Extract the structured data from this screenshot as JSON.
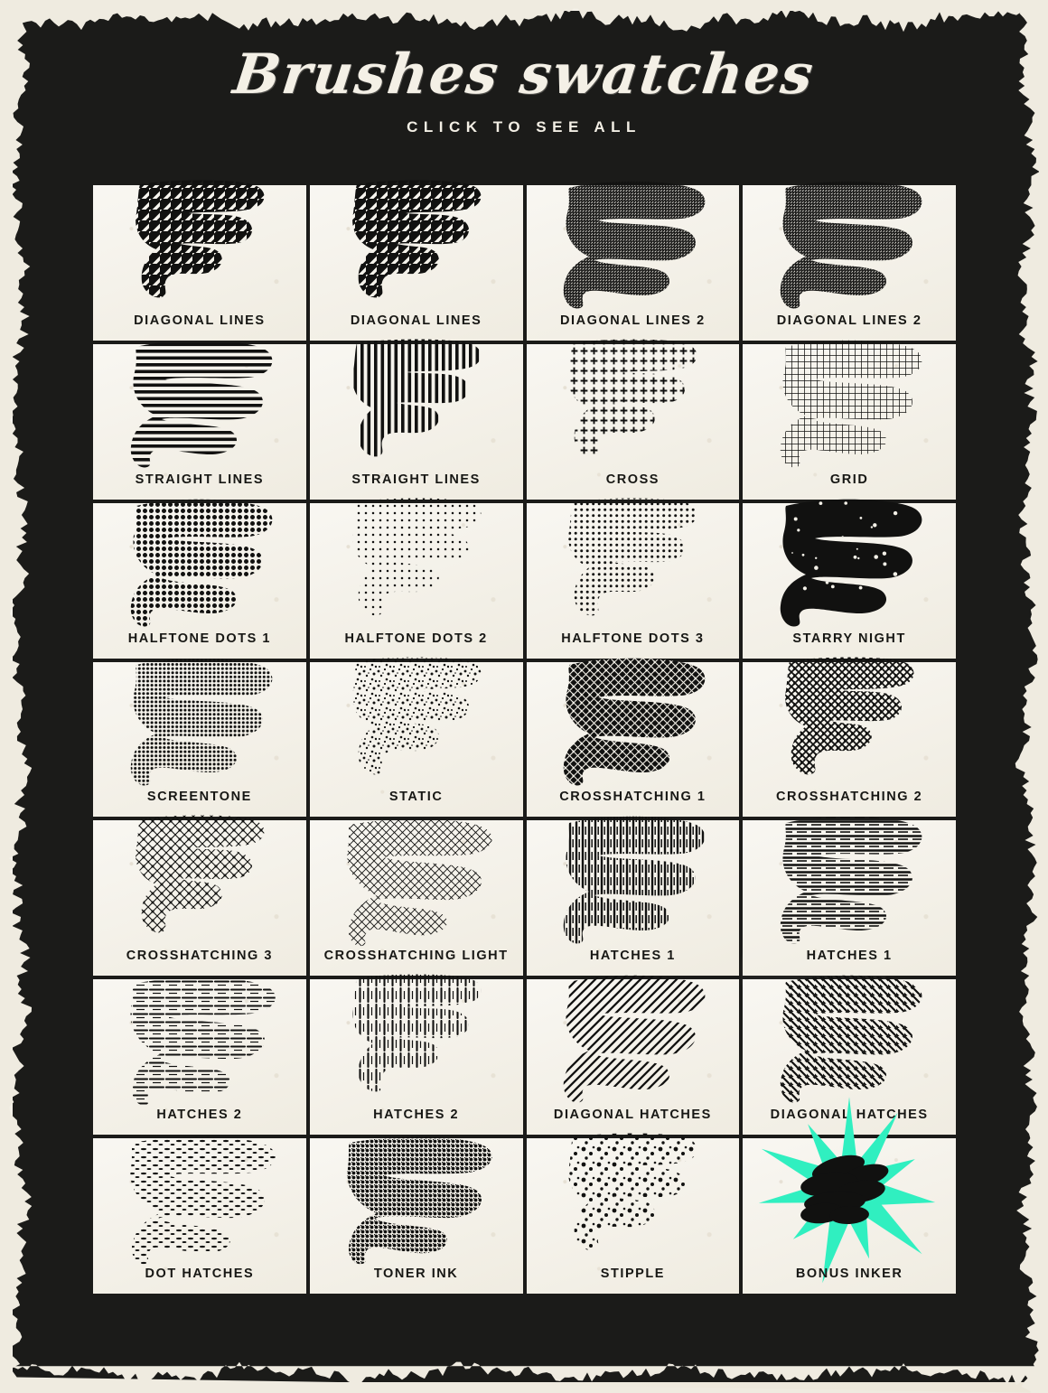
{
  "header": {
    "title": "Brushes swatches",
    "subtitle": "CLICK TO SEE ALL"
  },
  "colors": {
    "frame_dark": "#1b1b19",
    "paper_cream": "#f3f0e7",
    "ink_black": "#111110",
    "accent_teal": "#30efc0"
  },
  "swatches": [
    {
      "label": "DIAGONAL LINES",
      "pattern": "diag-coarse"
    },
    {
      "label": "DIAGONAL LINES",
      "pattern": "diag-coarse-b"
    },
    {
      "label": "DIAGONAL LINES 2",
      "pattern": "diag-fine"
    },
    {
      "label": "DIAGONAL LINES 2",
      "pattern": "diag-fine-b"
    },
    {
      "label": "STRAIGHT LINES",
      "pattern": "horiz-lines"
    },
    {
      "label": "STRAIGHT LINES",
      "pattern": "vert-lines"
    },
    {
      "label": "CROSS",
      "pattern": "cross-plus"
    },
    {
      "label": "GRID",
      "pattern": "grid-mesh"
    },
    {
      "label": "HALFTONE DOTS 1",
      "pattern": "halftone-1"
    },
    {
      "label": "HALFTONE DOTS 2",
      "pattern": "halftone-2"
    },
    {
      "label": "HALFTONE DOTS 3",
      "pattern": "halftone-3"
    },
    {
      "label": "STARRY NIGHT",
      "pattern": "starry"
    },
    {
      "label": "SCREENTONE",
      "pattern": "screentone"
    },
    {
      "label": "STATIC",
      "pattern": "static"
    },
    {
      "label": "CROSSHATCHING 1",
      "pattern": "xhatch-1"
    },
    {
      "label": "CROSSHATCHING 2",
      "pattern": "xhatch-2"
    },
    {
      "label": "CROSSHATCHING 3",
      "pattern": "xhatch-3"
    },
    {
      "label": "CROSSHATCHING LIGHT",
      "pattern": "xhatch-light"
    },
    {
      "label": "HATCHES 1",
      "pattern": "hatches-1a"
    },
    {
      "label": "HATCHES 1",
      "pattern": "hatches-1b"
    },
    {
      "label": "HATCHES 2",
      "pattern": "hatches-2a"
    },
    {
      "label": "HATCHES 2",
      "pattern": "hatches-2b"
    },
    {
      "label": "DIAGONAL HATCHES",
      "pattern": "diag-hatch-a"
    },
    {
      "label": "DIAGONAL HATCHES",
      "pattern": "diag-hatch-b"
    },
    {
      "label": "DOT HATCHES",
      "pattern": "dot-hatches"
    },
    {
      "label": "TONER INK",
      "pattern": "toner-ink"
    },
    {
      "label": "STIPPLE",
      "pattern": "stipple"
    },
    {
      "label": "BONUS INKER",
      "pattern": "bonus-inker"
    }
  ]
}
